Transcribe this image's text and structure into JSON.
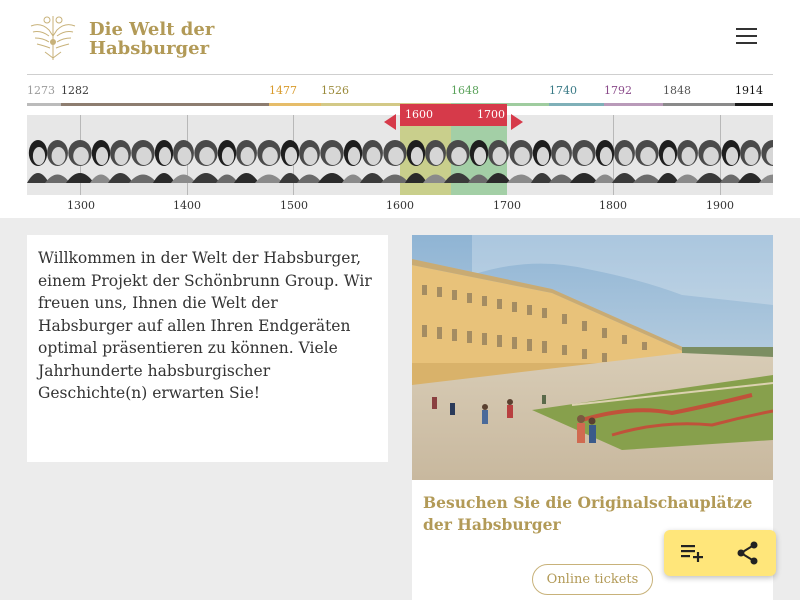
{
  "header": {
    "brand_line1": "Die Welt der",
    "brand_line2": "Habsburger",
    "menu_icon": "hamburger-menu-icon"
  },
  "timeline": {
    "dynasty_years": [
      {
        "label": "1273",
        "color": "#9b9b9b"
      },
      {
        "label": "1282",
        "color": "#3b3b3b"
      },
      {
        "label": "1477",
        "color": "#d89a2a"
      },
      {
        "label": "1526",
        "color": "#9a8a3a"
      },
      {
        "label": "1648",
        "color": "#5aa25a"
      },
      {
        "label": "1740",
        "color": "#3a7a86"
      },
      {
        "label": "1792",
        "color": "#8a4a8a"
      },
      {
        "label": "1848",
        "color": "#555555"
      },
      {
        "label": "1914",
        "color": "#111111"
      }
    ],
    "selected_range": {
      "start": "1600",
      "end": "1700",
      "color": "#d63a4a"
    },
    "centuries": [
      "1300",
      "1400",
      "1500",
      "1600",
      "1700",
      "1800",
      "1900"
    ]
  },
  "welcome": {
    "text": "Willkommen in der Welt der Habsburger, einem Projekt der Schönbrunn Group. Wir freuen uns, Ihnen die Welt der Habsburger auf allen Ihren Endgeräten optimal präsentieren zu können. Viele Jahrhunderte habsburgischer Geschichte(n) erwarten Sie!"
  },
  "visit": {
    "title": "Besuchen Sie die Originalschauplätze der Habsburger",
    "button": "Online tickets"
  },
  "actions": {
    "playlist_icon": "playlist-add-icon",
    "share_icon": "share-icon",
    "background": "#ffe67a"
  },
  "colors": {
    "brand": "#b29a57",
    "accent": "#d63a4a"
  }
}
